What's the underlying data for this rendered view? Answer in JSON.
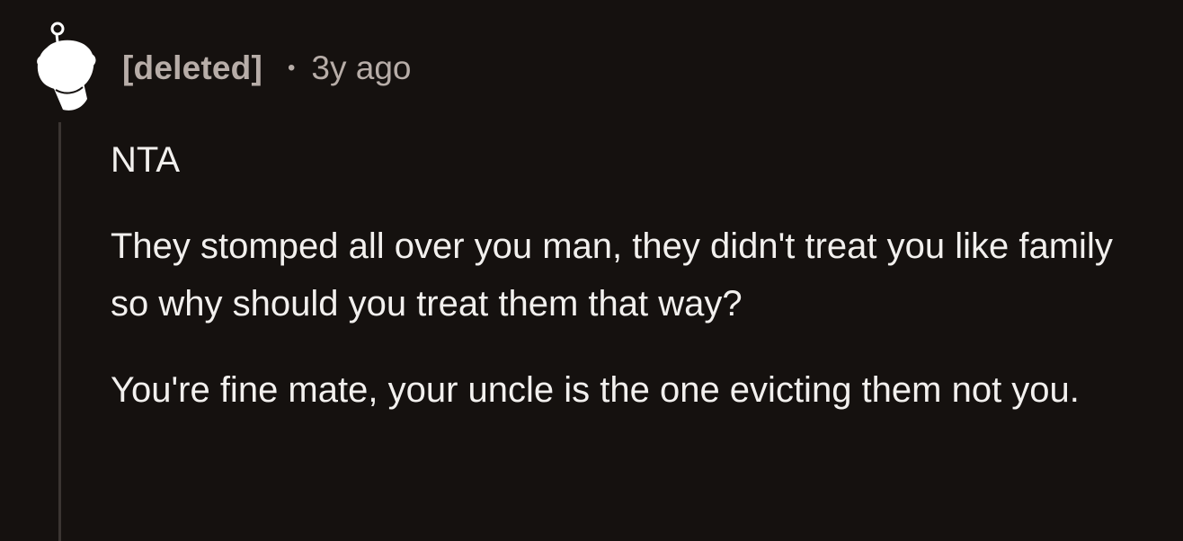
{
  "comment": {
    "author": "[deleted]",
    "separator": "•",
    "timestamp": "3y ago",
    "avatar_icon": "deleted-user-avatar-icon",
    "paragraphs": [
      "NTA",
      "They stomped all over you man, they didn't treat you like family so why should you treat them that way?",
      "You're fine mate, your uncle is the one evicting them not you."
    ]
  },
  "colors": {
    "background": "#15110f",
    "meta_text": "#b7ada8",
    "body_text": "#f2f0ee",
    "thread_line": "#3b3532"
  }
}
